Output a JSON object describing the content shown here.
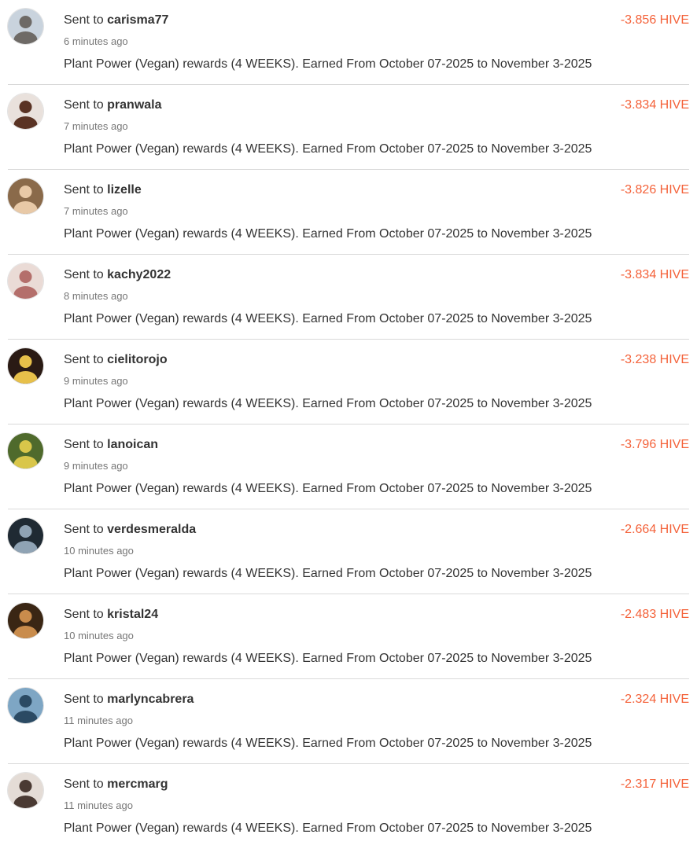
{
  "transfers": [
    {
      "prefix": "Sent to",
      "user": "carisma77",
      "time": "6 minutes ago",
      "memo": "Plant Power (Vegan) rewards (4 WEEKS). Earned From October 07-2025 to November 3-2025",
      "amount": "-3.856 HIVE",
      "avatar": {
        "bg": "#c9d3dd",
        "fg": "#6e6a66"
      }
    },
    {
      "prefix": "Sent to",
      "user": "pranwala",
      "time": "7 minutes ago",
      "memo": "Plant Power (Vegan) rewards (4 WEEKS). Earned From October 07-2025 to November 3-2025",
      "amount": "-3.834 HIVE",
      "avatar": {
        "bg": "#e9e1dc",
        "fg": "#5a3324"
      }
    },
    {
      "prefix": "Sent to",
      "user": "lizelle",
      "time": "7 minutes ago",
      "memo": "Plant Power (Vegan) rewards (4 WEEKS). Earned From October 07-2025 to November 3-2025",
      "amount": "-3.826 HIVE",
      "avatar": {
        "bg": "#8a6a4a",
        "fg": "#e8c9a7"
      }
    },
    {
      "prefix": "Sent to",
      "user": "kachy2022",
      "time": "8 minutes ago",
      "memo": "Plant Power (Vegan) rewards (4 WEEKS). Earned From October 07-2025 to November 3-2025",
      "amount": "-3.834 HIVE",
      "avatar": {
        "bg": "#eadbd6",
        "fg": "#b46f6b"
      }
    },
    {
      "prefix": "Sent to",
      "user": "cielitorojo",
      "time": "9 minutes ago",
      "memo": "Plant Power (Vegan) rewards (4 WEEKS). Earned From October 07-2025 to November 3-2025",
      "amount": "-3.238 HIVE",
      "avatar": {
        "bg": "#2a1a14",
        "fg": "#e7c04a"
      }
    },
    {
      "prefix": "Sent to",
      "user": "lanoican",
      "time": "9 minutes ago",
      "memo": "Plant Power (Vegan) rewards (4 WEEKS). Earned From October 07-2025 to November 3-2025",
      "amount": "-3.796 HIVE",
      "avatar": {
        "bg": "#4f6a2c",
        "fg": "#d9c64a"
      }
    },
    {
      "prefix": "Sent to",
      "user": "verdesmeralda",
      "time": "10 minutes ago",
      "memo": "Plant Power (Vegan) rewards (4 WEEKS). Earned From October 07-2025 to November 3-2025",
      "amount": "-2.664 HIVE",
      "avatar": {
        "bg": "#1f2a33",
        "fg": "#8fa3b4"
      }
    },
    {
      "prefix": "Sent to",
      "user": "kristal24",
      "time": "10 minutes ago",
      "memo": "Plant Power (Vegan) rewards (4 WEEKS). Earned From October 07-2025 to November 3-2025",
      "amount": "-2.483 HIVE",
      "avatar": {
        "bg": "#3a2614",
        "fg": "#c98c4c"
      }
    },
    {
      "prefix": "Sent to",
      "user": "marlyncabrera",
      "time": "11 minutes ago",
      "memo": "Plant Power (Vegan) rewards (4 WEEKS). Earned From October 07-2025 to November 3-2025",
      "amount": "-2.324 HIVE",
      "avatar": {
        "bg": "#7ea6c4",
        "fg": "#2b4a63"
      }
    },
    {
      "prefix": "Sent to",
      "user": "mercmarg",
      "time": "11 minutes ago",
      "memo": "Plant Power (Vegan) rewards (4 WEEKS). Earned From October 07-2025 to November 3-2025",
      "amount": "-2.317 HIVE",
      "avatar": {
        "bg": "#e4dcd6",
        "fg": "#4a3a33"
      }
    }
  ]
}
